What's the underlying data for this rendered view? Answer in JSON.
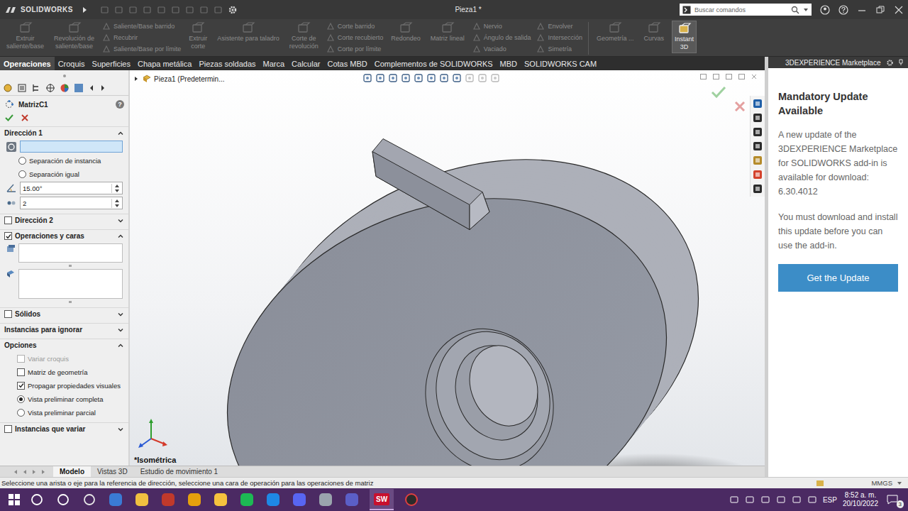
{
  "app": {
    "logo": "SOLIDWORKS",
    "title": "Pieza1 *",
    "search_placeholder": "Buscar comandos"
  },
  "ribbon": [
    {
      "kind": "large",
      "lines": [
        "Extruir",
        "saliente/base"
      ],
      "disabled": true,
      "selected": false
    },
    {
      "kind": "large",
      "lines": [
        "Revolución de",
        "saliente/base"
      ],
      "disabled": true,
      "selected": false
    },
    {
      "kind": "stack",
      "items": [
        {
          "label": "Saliente/Base barrido",
          "disabled": true
        },
        {
          "label": "Recubrir",
          "disabled": true
        },
        {
          "label": "Saliente/Base por límite",
          "disabled": true
        }
      ]
    },
    {
      "kind": "large",
      "lines": [
        "Extruir",
        "corte"
      ],
      "disabled": true,
      "selected": false
    },
    {
      "kind": "large",
      "lines": [
        "Asistente para taladro"
      ],
      "disabled": true,
      "selected": false
    },
    {
      "kind": "large",
      "lines": [
        "Corte de",
        "revolución"
      ],
      "disabled": true,
      "selected": false
    },
    {
      "kind": "stack",
      "items": [
        {
          "label": "Corte barrido",
          "disabled": true
        },
        {
          "label": "Corte recubierto",
          "disabled": true
        },
        {
          "label": "Corte por límite",
          "disabled": true
        }
      ]
    },
    {
      "kind": "large",
      "lines": [
        "Redondeo"
      ],
      "disabled": true,
      "selected": false
    },
    {
      "kind": "large",
      "lines": [
        "Matriz lineal"
      ],
      "disabled": true,
      "selected": false
    },
    {
      "kind": "stack",
      "items": [
        {
          "label": "Nervio",
          "disabled": true
        },
        {
          "label": "Ángulo de salida",
          "disabled": true
        },
        {
          "label": "Vaciado",
          "disabled": true
        }
      ]
    },
    {
      "kind": "stack",
      "items": [
        {
          "label": "Envolver",
          "disabled": true
        },
        {
          "label": "Intersección",
          "disabled": true
        },
        {
          "label": "Simetría",
          "disabled": true
        }
      ]
    },
    {
      "kind": "large",
      "lines": [
        "Geometría ..."
      ],
      "disabled": true,
      "selected": false
    },
    {
      "kind": "large",
      "lines": [
        "Curvas"
      ],
      "disabled": true,
      "selected": false
    },
    {
      "kind": "large",
      "lines": [
        "Instant",
        "3D"
      ],
      "disabled": false,
      "selected": true
    }
  ],
  "tabs": [
    {
      "label": "Operaciones",
      "selected": true
    },
    {
      "label": "Croquis",
      "selected": false
    },
    {
      "label": "Superficies",
      "selected": false
    },
    {
      "label": "Chapa metálica",
      "selected": false
    },
    {
      "label": "Piezas soldadas",
      "selected": false
    },
    {
      "label": "Marca",
      "selected": false
    },
    {
      "label": "Calcular",
      "selected": false
    },
    {
      "label": "Cotas MBD",
      "selected": false
    },
    {
      "label": "Complementos de SOLIDWORKS",
      "selected": false
    },
    {
      "label": "MBD",
      "selected": false
    },
    {
      "label": "SOLIDWORKS CAM",
      "selected": false
    }
  ],
  "property_manager": {
    "title": "MatrizC1",
    "help": "?",
    "direction1": {
      "title": "Dirección 1",
      "expanded": true,
      "reference_active": true,
      "spacing": [
        {
          "label": "Separación de instancia",
          "selected": false
        },
        {
          "label": "Separación igual",
          "selected": false
        }
      ],
      "angle": "15.00°",
      "count": "2"
    },
    "direction2": {
      "title": "Dirección 2",
      "checked": false,
      "expanded": false
    },
    "features": {
      "title": "Operaciones y caras",
      "checked": true,
      "expanded": true
    },
    "bodies": {
      "title": "Sólidos",
      "checked": false,
      "expanded": false
    },
    "skip": {
      "title": "Instancias para ignorar",
      "expanded": false
    },
    "options": {
      "title": "Opciones",
      "expanded": true,
      "items": [
        {
          "kind": "checkbox",
          "label": "Variar croquis",
          "checked": false,
          "disabled": true
        },
        {
          "kind": "checkbox",
          "label": "Matriz de geometría",
          "checked": false,
          "disabled": false
        },
        {
          "kind": "checkbox",
          "label": "Propagar propiedades visuales",
          "checked": true,
          "disabled": false
        },
        {
          "kind": "radio",
          "label": "Vista preliminar completa",
          "checked": true,
          "disabled": false
        },
        {
          "kind": "radio",
          "label": "Vista preliminar parcial",
          "checked": false,
          "disabled": false
        }
      ]
    },
    "vary": {
      "title": "Instancias que variar",
      "checked": false,
      "expanded": false
    }
  },
  "graphics": {
    "breadcrumb": "Pieza1 (Predetermin...",
    "view_label": "*Isométrica"
  },
  "marketplace": {
    "header": "3DEXPERIENCE Marketplace",
    "heading": "Mandatory Update Available",
    "paragraphs": [
      "A new update of the 3DEXPERIENCE Marketplace for SOLIDWORKS add-in is available for download: 6.30.4012",
      "You must download and install this update before you can use the add-in."
    ],
    "button": "Get the Update"
  },
  "bottom_tabs": [
    {
      "label": "Modelo",
      "selected": true
    },
    {
      "label": "Vistas 3D",
      "selected": false
    },
    {
      "label": "Estudio de movimiento 1",
      "selected": false
    }
  ],
  "status_bar": {
    "message": "Seleccione una arista o eje para la referencia de dirección, seleccione una cara de operación para las operaciones de matriz",
    "units": "MMGS"
  },
  "taskbar": {
    "active_app": "SW",
    "language": "ESP",
    "time": "8:52 a. m.",
    "date": "20/10/2022",
    "notifications": "3"
  }
}
